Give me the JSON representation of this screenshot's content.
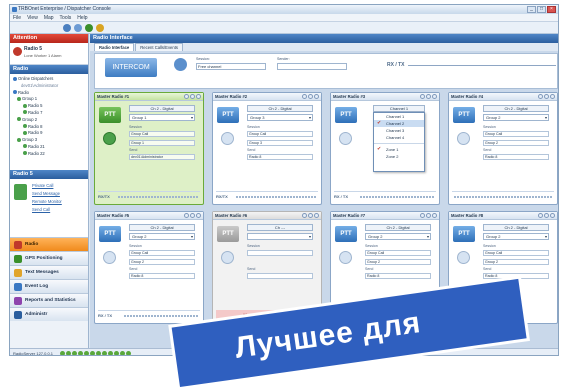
{
  "window": {
    "title": "TRBOnet Enterprise / Dispatcher Console",
    "controls": [
      "_",
      "□",
      "×"
    ]
  },
  "menu": [
    "File",
    "View",
    "Map",
    "Tools",
    "Help"
  ],
  "sidebar": {
    "attention": {
      "title": "Attention",
      "radio": "Radio 5",
      "alarm": "Lone Worker 1 Alarm"
    },
    "radio_header": "Radio",
    "tree": [
      "Online Dispatchers",
      "dev01\\Administrator",
      "Radio",
      "Group 1",
      "Radio 5",
      "Radio 7",
      "Group 2",
      "Radio 8",
      "Radio 9",
      "Group 3",
      "Radio 21",
      "Radio 22"
    ],
    "radio5_header": "Radio 5",
    "radio5_links": [
      "Private Call",
      "Send Message",
      "Remote Monitor",
      "Send Call"
    ],
    "nav": [
      "Radio",
      "GPS Positioning",
      "Text Messages",
      "Event Log",
      "Reports and Statistics",
      "Administr"
    ]
  },
  "status": {
    "text": "RadioServer 127.0.0.1"
  },
  "main": {
    "title": "Radio Interface",
    "tabs": [
      "Radio Interface",
      "Recent Calls/Events"
    ],
    "intercom": {
      "button": "INTERCOM",
      "session_label": "Session:",
      "session_value": "Free channel",
      "sender_label": "Sender:",
      "sender_value": "",
      "rxtx": "RX / TX"
    }
  },
  "panels": [
    {
      "title": "Master Radio #1",
      "ptt": "PTT",
      "channel": "Ch 2 - Digital",
      "group": "Group 1",
      "session_label": "Session",
      "session": "Group Call",
      "target": "Group 1",
      "sendr_label": "Send",
      "sender": "dev01\\Administrator",
      "rx": "RX/TX",
      "state": "active"
    },
    {
      "title": "Master Radio #2",
      "ptt": "PTT",
      "channel": "Ch 2 - Digital",
      "group": "Group 3",
      "session_label": "Session",
      "session": "Group Call",
      "target": "Group 3",
      "sendr_label": "Send",
      "sender": "Radio 8",
      "rx": "RX/TX",
      "state": "normal"
    },
    {
      "title": "Master Radio #3",
      "ptt": "PTT",
      "channel": "Channel 1",
      "group": "",
      "session_label": "",
      "session": "",
      "target": "",
      "sendr_label": "",
      "sender": "",
      "rx": "RX / TX",
      "state": "dropdown"
    },
    {
      "title": "Master Radio #4",
      "ptt": "PTT",
      "channel": "Ch 2 - Digital",
      "group": "Group 2",
      "session_label": "Session",
      "session": "Group Call",
      "target": "Group 2",
      "sendr_label": "Send",
      "sender": "Radio 8",
      "rx": "",
      "state": "normal"
    },
    {
      "title": "Master Radio #5",
      "ptt": "PTT",
      "channel": "Ch 2 - Digital",
      "group": "Group 2",
      "session_label": "Session",
      "session": "Group Call",
      "target": "Group 2",
      "sendr_label": "Send",
      "sender": "Radio 8",
      "rx": "RX / TX",
      "state": "normal"
    },
    {
      "title": "Master Radio #6",
      "ptt": "PTT",
      "channel": "Ch ---",
      "group": "",
      "session_label": "Session",
      "session": "",
      "target": "",
      "sendr_label": "Send",
      "sender": "",
      "rx": "MasterRadio disconnected",
      "state": "disc"
    },
    {
      "title": "Master Radio #7",
      "ptt": "PTT",
      "channel": "Ch 2 - Digital",
      "group": "Group 2",
      "session_label": "Session",
      "session": "Group Call",
      "target": "Group 2",
      "sendr_label": "Send",
      "sender": "Radio 8",
      "rx": "",
      "state": "normal"
    },
    {
      "title": "Master Radio #8",
      "ptt": "PTT",
      "channel": "Ch 2 - Digital",
      "group": "Group 2",
      "session_label": "Session",
      "session": "Group Call",
      "target": "Group 2",
      "sendr_label": "Send",
      "sender": "Radio 8",
      "rx": "",
      "state": "normal"
    }
  ],
  "dropdown": {
    "items": [
      "Channel 1",
      "Channel 2",
      "Channel 3",
      "Channel 4"
    ],
    "selected": "Channel 2",
    "zones": [
      "Zone 1",
      "Zone 2"
    ],
    "zone_selected": "Zone 1"
  },
  "banner": {
    "text": "Лучшее для"
  },
  "colors": {
    "accent": "#2b5e9e",
    "alert": "#c0392b",
    "active_panel": "#def0c7",
    "nav_active": "#f08a1c",
    "banner": "#2f5fbf"
  }
}
